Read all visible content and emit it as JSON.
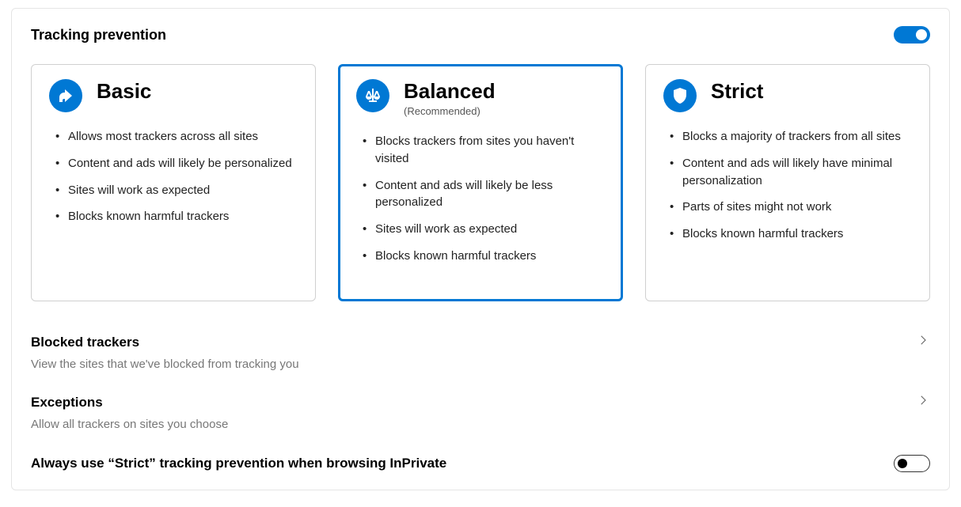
{
  "colors": {
    "accent": "#0078d4"
  },
  "header": {
    "title": "Tracking prevention",
    "toggle_on": true
  },
  "cards": [
    {
      "id": "basic",
      "title": "Basic",
      "subtitle": "",
      "selected": false,
      "bullets": [
        "Allows most trackers across all sites",
        "Content and ads will likely be personalized",
        "Sites will work as expected",
        "Blocks known harmful trackers"
      ]
    },
    {
      "id": "balanced",
      "title": "Balanced",
      "subtitle": "(Recommended)",
      "selected": true,
      "bullets": [
        "Blocks trackers from sites you haven't visited",
        "Content and ads will likely be less personalized",
        "Sites will work as expected",
        "Blocks known harmful trackers"
      ]
    },
    {
      "id": "strict",
      "title": "Strict",
      "subtitle": "",
      "selected": false,
      "bullets": [
        "Blocks a majority of trackers from all sites",
        "Content and ads will likely have minimal personalization",
        "Parts of sites might not work",
        "Blocks known harmful trackers"
      ]
    }
  ],
  "links": {
    "blocked": {
      "title": "Blocked trackers",
      "desc": "View the sites that we've blocked from tracking you"
    },
    "exceptions": {
      "title": "Exceptions",
      "desc": "Allow all trackers on sites you choose"
    }
  },
  "strict_inprivate": {
    "label": "Always use “Strict” tracking prevention when browsing InPrivate",
    "toggle_on": false
  }
}
